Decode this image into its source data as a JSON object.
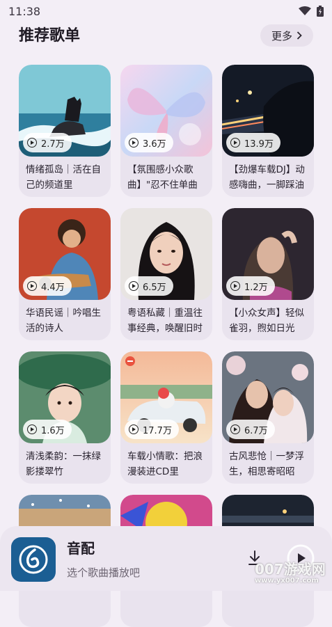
{
  "status_bar": {
    "time": "11:38"
  },
  "header": {
    "title": "推荐歌单",
    "more_label": "更多"
  },
  "playlists": [
    {
      "plays": "2.7万",
      "title": "情绪孤岛｜活在自己的频道里",
      "icon": "cat-on-rock-cover"
    },
    {
      "plays": "3.6万",
      "title": "【氛围感小众歌曲】\"忍不住单曲循环",
      "icon": "butterfly-cover"
    },
    {
      "plays": "13.9万",
      "title": "【劲爆车载DJ】动感嗨曲，一脚踩油门",
      "icon": "car-night-cover"
    },
    {
      "plays": "4.4万",
      "title": "华语民谣｜吟唱生活的诗人",
      "icon": "guitar-boy-cover"
    },
    {
      "plays": "6.5万",
      "title": "粤语私藏｜重温往事经典，唤醒旧时光",
      "icon": "woman-portrait-cover"
    },
    {
      "plays": "1.2万",
      "title": "【小众女声】轻似雀羽，煦如日光",
      "icon": "girl-night-cover"
    },
    {
      "plays": "1.6万",
      "title": "清浅柔韵：一抹绿影搂翠竹",
      "icon": "green-hat-girl-cover"
    },
    {
      "plays": "17.7万",
      "title": "车载小情歌：把浪漫装进CD里",
      "icon": "cartoon-car-cover"
    },
    {
      "plays": "6.7万",
      "title": "古风悲怆｜一梦浮生，相思寄昭昭",
      "icon": "ancient-couple-cover"
    }
  ],
  "player": {
    "name": "音配",
    "subtitle": "选个歌曲播放吧"
  },
  "watermark": {
    "text": "007游戏网",
    "url": "www.yx007.com"
  },
  "colors": {
    "background": "#f3eef6",
    "card": "#e9e3ee",
    "logo": "#1b5e93"
  }
}
